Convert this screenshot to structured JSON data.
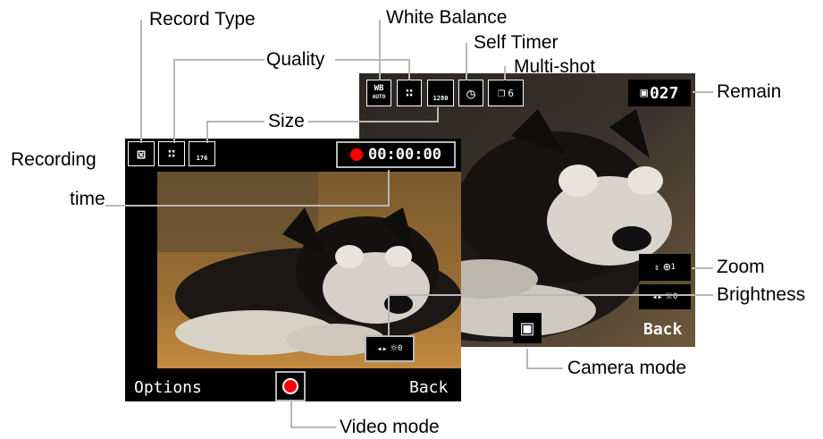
{
  "labels": {
    "record_type": "Record Type",
    "white_balance": "White Balance",
    "quality": "Quality",
    "self_timer": "Self Timer",
    "multi_shot": "Multi-shot",
    "remain": "Remain",
    "size": "Size",
    "recording": "Recording",
    "time": "time",
    "zoom": "Zoom",
    "brightness": "Brightness",
    "camera_mode": "Camera mode",
    "video_mode": "Video mode"
  },
  "camera": {
    "wb_top": "WB",
    "wb_bottom": "AUTO",
    "size_value": "1280",
    "multishot_count": "6",
    "remain_value": "027",
    "zoom_sub": "1",
    "brightness_sub": "0",
    "back_label": "Back"
  },
  "video": {
    "size_value": "176",
    "recording_time": "00:00:00",
    "brightness_sub": "0",
    "options_label": "Options",
    "back_label": "Back"
  },
  "colors": {
    "record_red": "#ff0000",
    "guide_line": "#b8b8b8",
    "screen_bg": "#000000"
  }
}
